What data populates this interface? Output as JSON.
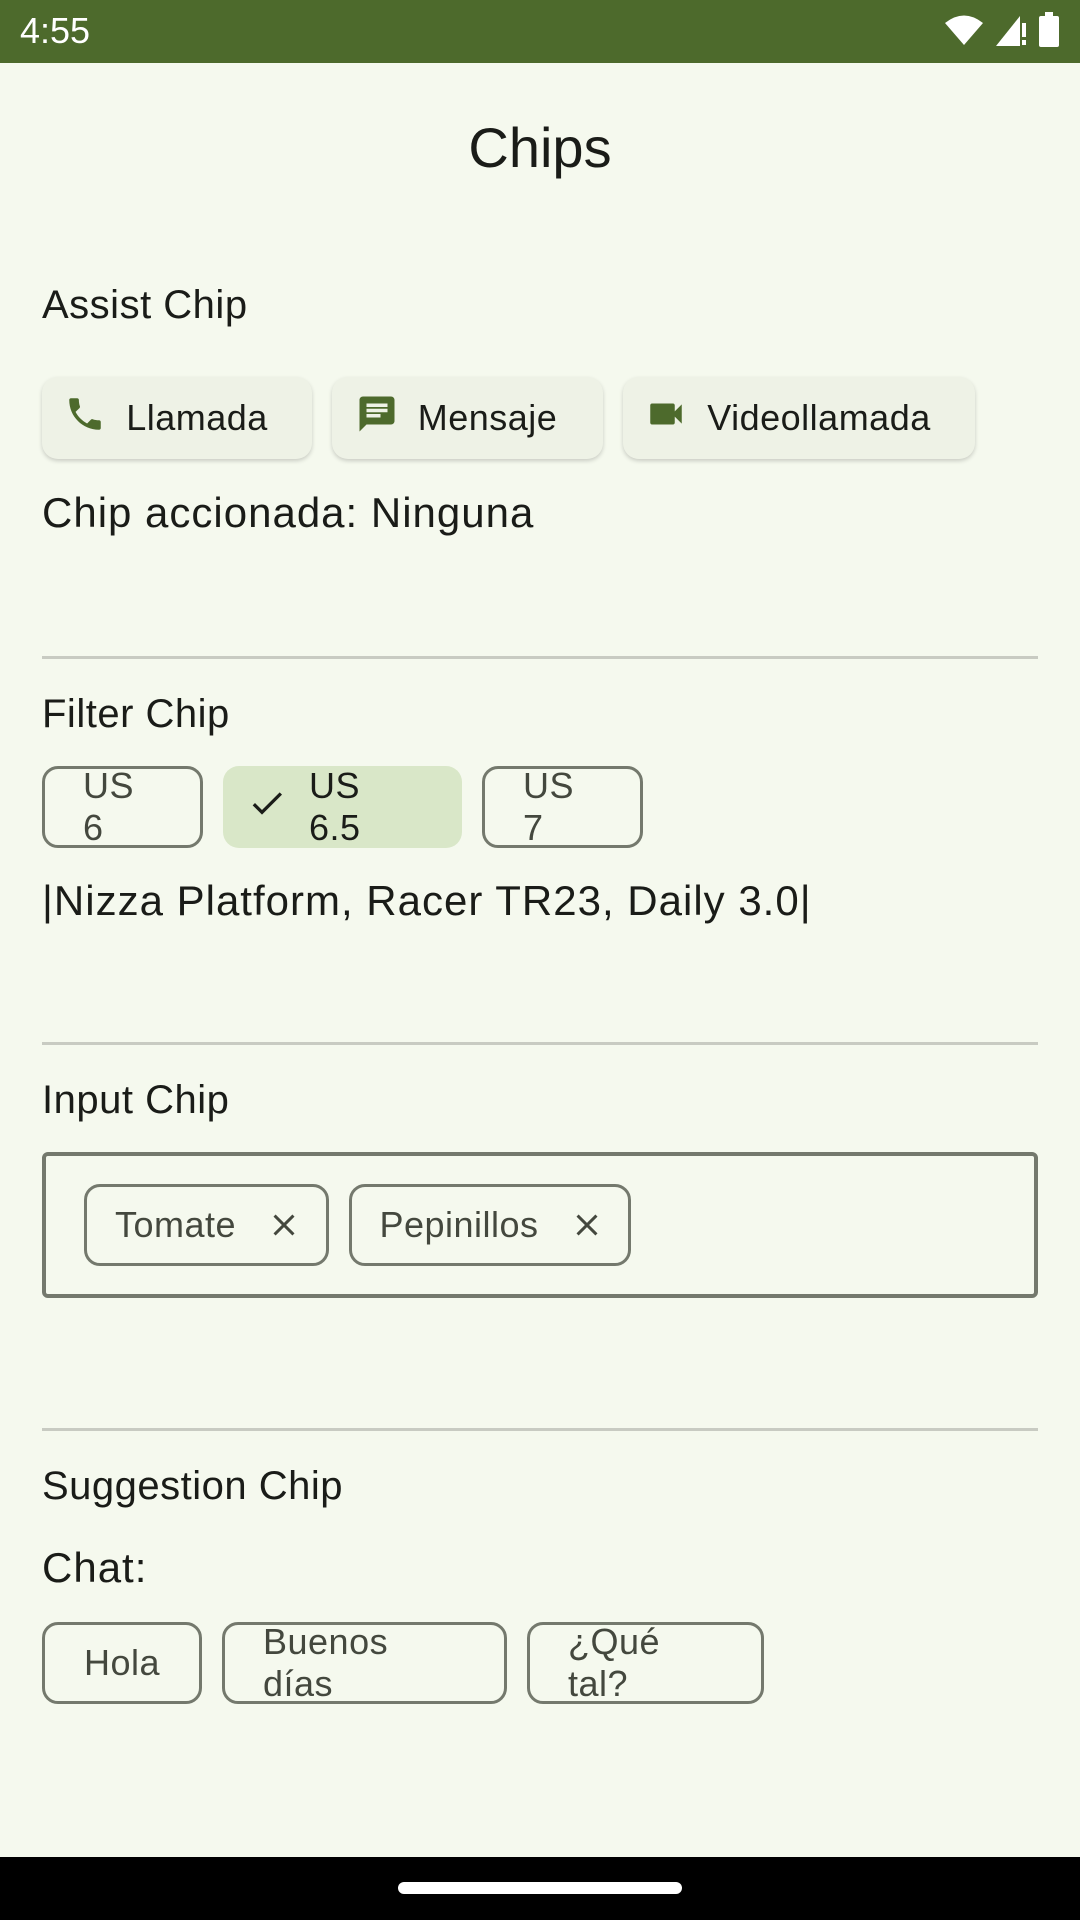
{
  "status_bar": {
    "time": "4:55",
    "icons": [
      "wifi-icon",
      "signal-icon",
      "battery-icon"
    ]
  },
  "app": {
    "title": "Chips"
  },
  "assist_section": {
    "title": "Assist Chip",
    "chips": [
      {
        "label": "Llamada",
        "icon": "phone-icon"
      },
      {
        "label": "Mensaje",
        "icon": "message-icon"
      },
      {
        "label": "Videollamada",
        "icon": "videocam-icon"
      }
    ],
    "status": "Chip accionada: Ninguna"
  },
  "filter_section": {
    "title": "Filter Chip",
    "chips": [
      {
        "label": "US 6",
        "selected": false
      },
      {
        "label": "US 6.5",
        "selected": true,
        "icon": "check-icon"
      },
      {
        "label": "US 7",
        "selected": false
      }
    ],
    "result": "|Nizza Platform, Racer TR23, Daily 3.0|"
  },
  "input_section": {
    "title": "Input Chip",
    "chips": [
      {
        "label": "Tomate",
        "icon": "close-icon"
      },
      {
        "label": "Pepinillos",
        "icon": "close-icon"
      }
    ]
  },
  "suggestion_section": {
    "title": "Suggestion Chip",
    "chat_label": "Chat:",
    "chips": [
      {
        "label": "Hola"
      },
      {
        "label": "Buenos días"
      },
      {
        "label": "¿Qué tal?"
      }
    ]
  },
  "colors": {
    "status_bar": "#4d6a2c",
    "background": "#f5f9ee",
    "icon_green": "#4d6a2c",
    "selected_chip": "#d9e7c8",
    "outline": "#74796d"
  }
}
